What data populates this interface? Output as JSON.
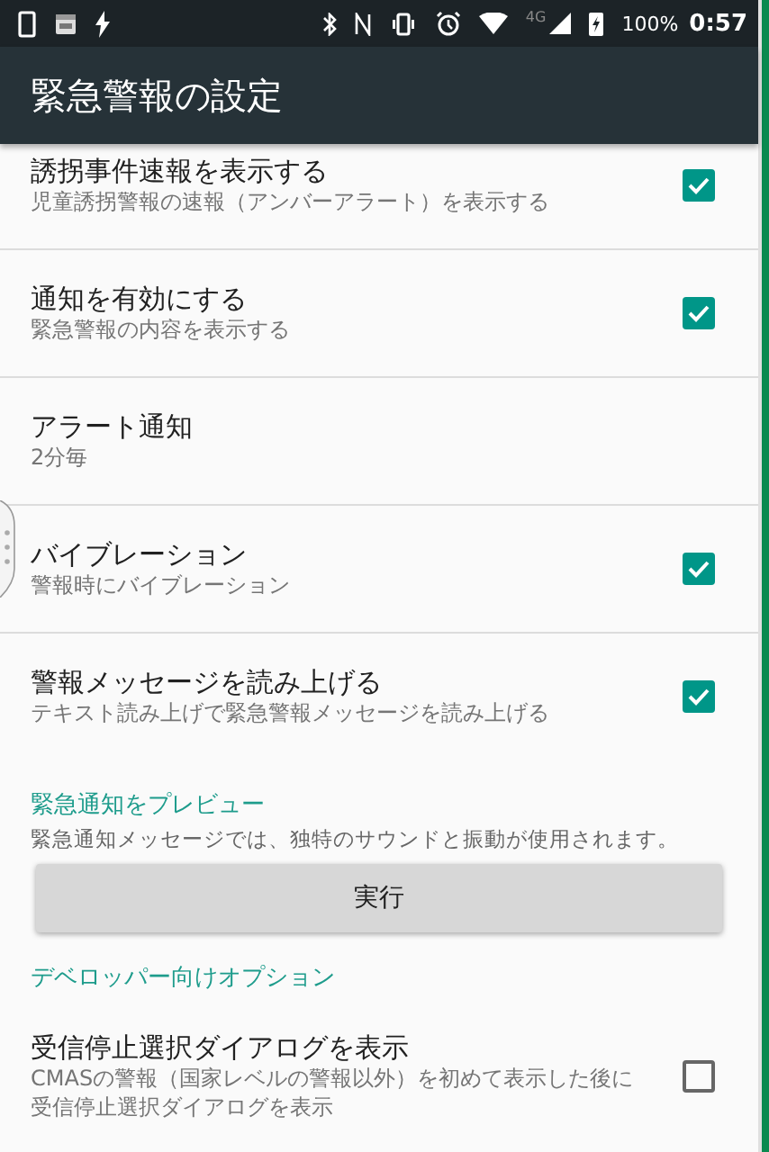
{
  "status_bar": {
    "network": "4G",
    "battery": "100%",
    "time": "0:57"
  },
  "app_bar": {
    "title": "緊急警報の設定"
  },
  "items": [
    {
      "kind": "checkbox",
      "title": "誘拐事件速報を表示する",
      "summary": "児童誘拐警報の速報（アンバーアラート）を表示する",
      "checked": true
    },
    {
      "kind": "checkbox",
      "title": "通知を有効にする",
      "summary": "緊急警報の内容を表示する",
      "checked": true
    },
    {
      "kind": "text",
      "title": "アラート通知",
      "summary": "2分毎"
    },
    {
      "kind": "checkbox",
      "title": "バイブレーション",
      "summary": "警報時にバイブレーション",
      "checked": true
    },
    {
      "kind": "checkbox",
      "title": "警報メッセージを読み上げる",
      "summary": "テキスト読み上げで緊急警報メッセージを読み上げる",
      "checked": true
    },
    {
      "kind": "category",
      "title": "緊急通知をプレビュー"
    },
    {
      "kind": "note",
      "summary": "緊急通知メッセージでは、独特のサウンドと振動が使用されます。"
    },
    {
      "kind": "button",
      "label": "実行"
    },
    {
      "kind": "category",
      "title": "デベロッパー向けオプション"
    },
    {
      "kind": "checkbox",
      "title": "受信停止選択ダイアログを表示",
      "summary": "CMASの警報（国家レベルの警報以外）を初めて表示した後に受信停止選択ダイアログを表示",
      "checked": false
    }
  ]
}
